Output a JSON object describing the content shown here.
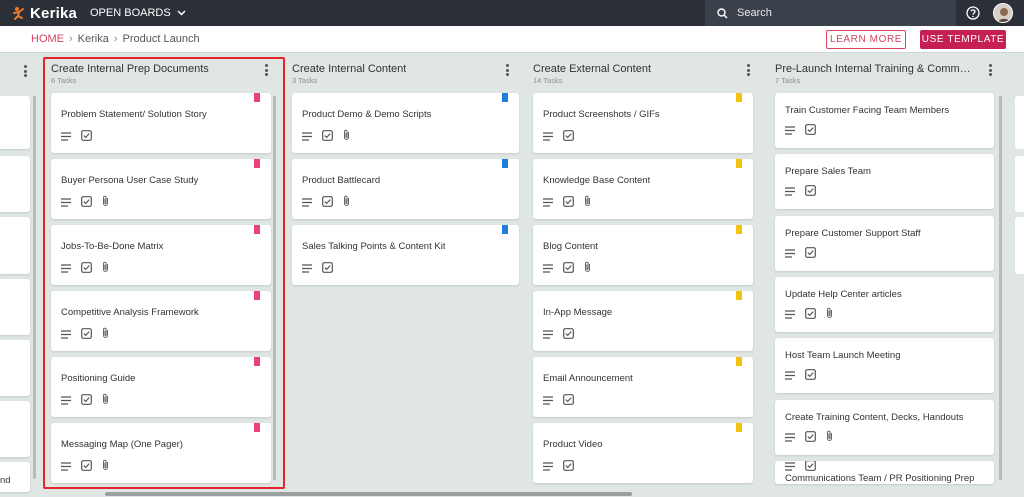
{
  "header": {
    "logo_text": "Kerika",
    "open_boards_label": "OPEN BOARDS",
    "search_placeholder": "Search"
  },
  "breadcrumb": {
    "home": "HOME",
    "board": "Kerika",
    "page": "Product Launch"
  },
  "actions": {
    "learn_more": "LEARN MORE",
    "use_template": "USE TEMPLATE"
  },
  "left_partial": {
    "last_label": "nd"
  },
  "columns": [
    {
      "title": "Create Internal Prep Documents",
      "count": "6 Tasks",
      "cards": [
        {
          "title": "Problem Statement/ Solution Story",
          "attachment": false,
          "flag": "#e8437a"
        },
        {
          "title": "Buyer Persona User Case Study",
          "attachment": true,
          "flag": "#e8437a"
        },
        {
          "title": "Jobs-To-Be-Done Matrix",
          "attachment": true,
          "flag": "#e8437a"
        },
        {
          "title": "Competitive Analysis Framework",
          "attachment": true,
          "flag": "#e8437a"
        },
        {
          "title": "Positioning Guide",
          "attachment": true,
          "flag": "#e8437a"
        },
        {
          "title": "Messaging Map (One Pager)",
          "attachment": true,
          "flag": "#e8437a"
        }
      ]
    },
    {
      "title": "Create Internal Content",
      "count": "3 Tasks",
      "cards": [
        {
          "title": "Product Demo & Demo Scripts",
          "attachment": true,
          "flag": "#1e7fd6"
        },
        {
          "title": "Product Battlecard",
          "attachment": true,
          "flag": "#1e7fd6"
        },
        {
          "title": "Sales Talking Points & Content Kit",
          "attachment": false,
          "flag": "#1e7fd6"
        }
      ]
    },
    {
      "title": "Create External Content",
      "count": "14 Tasks",
      "cards": [
        {
          "title": "Product Screenshots / GIFs",
          "attachment": false,
          "flag": "#f2c40f"
        },
        {
          "title": "Knowledge Base Content",
          "attachment": true,
          "flag": "#f2c40f"
        },
        {
          "title": "Blog Content",
          "attachment": true,
          "flag": "#f2c40f"
        },
        {
          "title": "In-App Message",
          "attachment": false,
          "flag": "#f2c40f"
        },
        {
          "title": "Email Announcement",
          "attachment": false,
          "flag": "#f2c40f"
        },
        {
          "title": "Product Video",
          "attachment": false,
          "flag": "#f2c40f"
        }
      ]
    },
    {
      "title": "Pre-Launch Internal Training & Communi...",
      "count": "7 Tasks",
      "cards": [
        {
          "title": "Train Customer Facing Team Members",
          "attachment": false,
          "flag": ""
        },
        {
          "title": "Prepare Sales Team",
          "attachment": false,
          "flag": ""
        },
        {
          "title": "Prepare Customer Support Staff",
          "attachment": false,
          "flag": ""
        },
        {
          "title": "Update Help Center articles",
          "attachment": true,
          "flag": ""
        },
        {
          "title": "Host Team Launch Meeting",
          "attachment": false,
          "flag": ""
        },
        {
          "title": "Create Training Content, Decks, Handouts",
          "attachment": true,
          "flag": ""
        },
        {
          "title": "Communications Team / PR Positioning Prep",
          "attachment": false,
          "flag": ""
        }
      ]
    }
  ]
}
